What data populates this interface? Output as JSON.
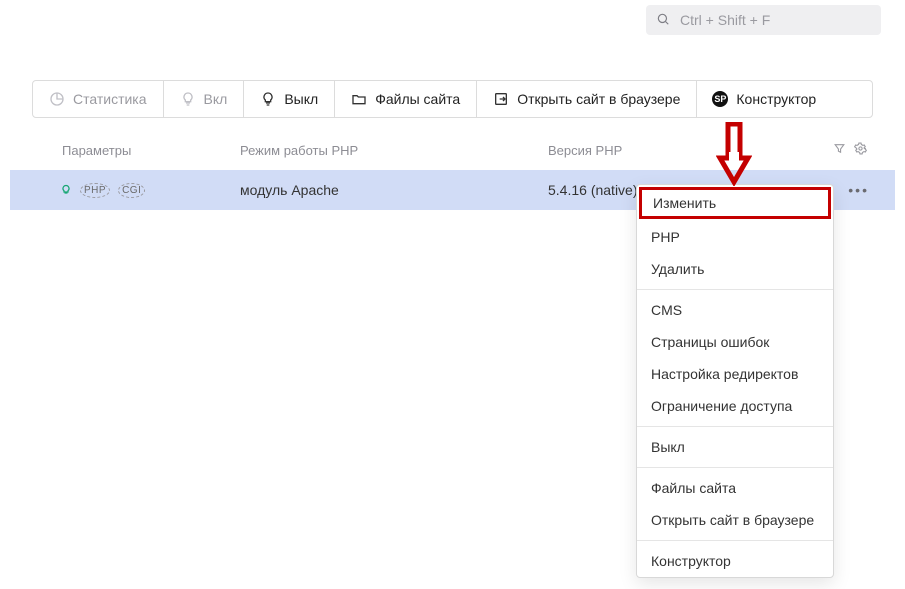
{
  "search": {
    "placeholder": "Ctrl + Shift + F"
  },
  "toolbar": {
    "stats": "Статистика",
    "on": "Вкл",
    "off": "Выкл",
    "files": "Файлы сайта",
    "open": "Открыть сайт в браузере",
    "builder": "Конструктор",
    "sp_badge": "SP"
  },
  "columns": {
    "params": "Параметры",
    "mode": "Режим работы PHP",
    "ver": "Версия PHP"
  },
  "row": {
    "params_chip_php": "PHP",
    "params_chip_cgi": "CGI",
    "mode": "модуль Apache",
    "ver": "5.4.16 (native)"
  },
  "menu": {
    "edit": "Изменить",
    "php": "PHP",
    "delete": "Удалить",
    "cms": "CMS",
    "error_pages": "Страницы ошибок",
    "redirects": "Настройка редиректов",
    "access": "Ограничение доступа",
    "off": "Выкл",
    "files": "Файлы сайта",
    "open": "Открыть сайт в браузере",
    "builder": "Конструктор"
  }
}
